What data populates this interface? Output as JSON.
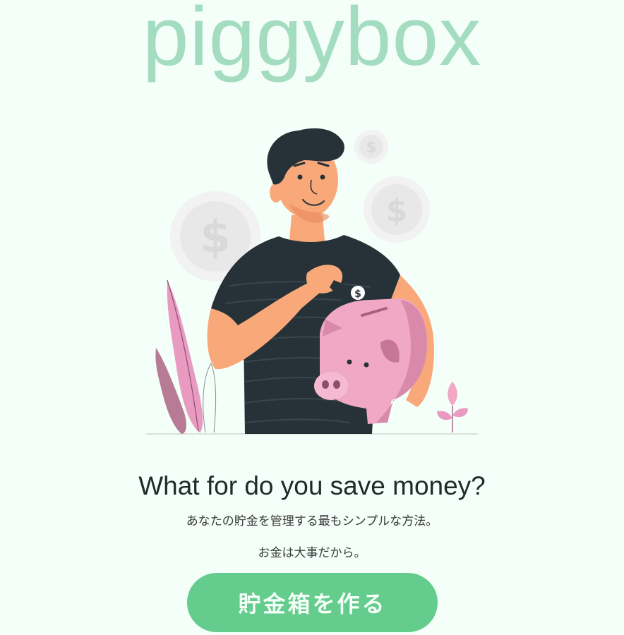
{
  "brand": {
    "logo_text": "piggybox",
    "logo_color": "#a4dcc1"
  },
  "hero": {
    "headline": "What for do you save money?",
    "subtitle": "あなたの貯金を管理する最もシンプルな方法。",
    "tagline": "お金は大事だから。"
  },
  "cta": {
    "label": "貯金箱を作る",
    "color": "#64cc8c"
  },
  "illustration": {
    "subject": "man-inserting-banknote-into-piggy-bank",
    "coin_symbol": "$"
  },
  "colors": {
    "background": "#f3fff8",
    "text": "#1f2a2a",
    "pig": "#f0a8c4",
    "shirt": "#263238",
    "skin": "#f9a87a"
  }
}
